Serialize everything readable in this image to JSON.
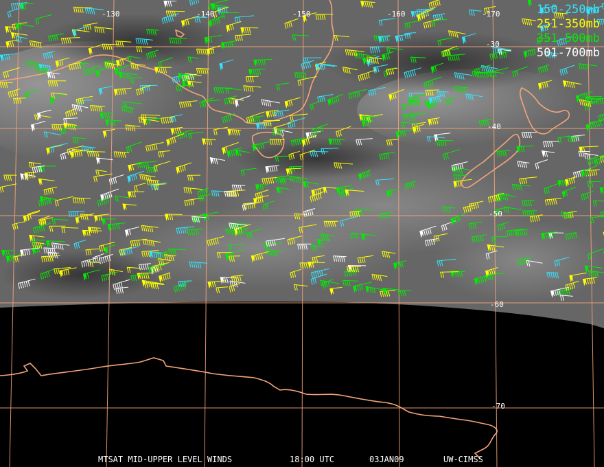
{
  "product": {
    "satellite_product": "MTSAT MID-UPPER LEVEL WINDS",
    "time": "18:00 UTC",
    "date": "03JAN09",
    "producer": "UW-CIMSS"
  },
  "legend": [
    {
      "label": "150-250mb",
      "color": "#33e5ff"
    },
    {
      "label": "251-350mb",
      "color": "#ffff00"
    },
    {
      "label": "351-500mb",
      "color": "#00ee00"
    },
    {
      "label": "501-700mb",
      "color": "#ffffff"
    }
  ],
  "grid": {
    "longitude_labels": [
      "-130",
      "-140",
      "-150",
      "-160",
      "-170"
    ],
    "latitude_labels": [
      "-30",
      "-40",
      "-50",
      "-60",
      "-70"
    ],
    "color": "#f5a57a"
  },
  "colors": {
    "coastline": "#f5a57a",
    "space": "#000000",
    "imagery": "#6a6a6a"
  }
}
